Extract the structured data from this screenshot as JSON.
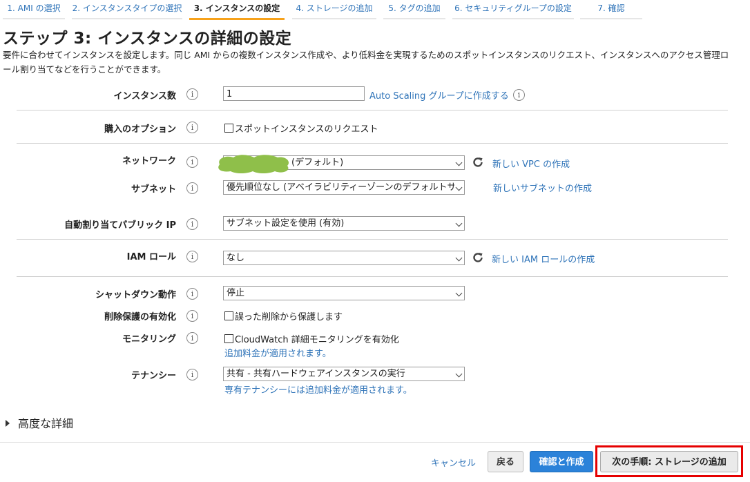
{
  "tabs": [
    {
      "label": "1. AMI の選択"
    },
    {
      "label": "2. インスタンスタイプの選択"
    },
    {
      "label": "3. インスタンスの設定"
    },
    {
      "label": "4. ストレージの追加"
    },
    {
      "label": "5. タグの追加"
    },
    {
      "label": "6. セキュリティグループの設定"
    },
    {
      "label": "7. 確認"
    }
  ],
  "page_title": "ステップ 3: インスタンスの詳細の設定",
  "description": "要件に合わせてインスタンスを設定します。同じ AMI からの複数インスタンス作成や、より低料金を実現するためのスポットインスタンスのリクエスト、インスタンスへのアクセス管理ロール割り当てなどを行うことができます。",
  "info_glyph": "i",
  "form": {
    "instance_count": {
      "label": "インスタンス数",
      "value": "1",
      "link": "Auto Scaling グループに作成する"
    },
    "purchase_option": {
      "label": "購入のオプション",
      "checkbox": "スポットインスタンスのリクエスト"
    },
    "network": {
      "label": "ネットワーク",
      "value": "(デフォルト)",
      "link": "新しい VPC の作成"
    },
    "subnet": {
      "label": "サブネット",
      "value": "優先順位なし (アベイラビリティーゾーンのデフォルトサブ",
      "link": "新しいサブネットの作成"
    },
    "public_ip": {
      "label": "自動割り当てパブリック IP",
      "value": "サブネット設定を使用 (有効)"
    },
    "iam_role": {
      "label": "IAM ロール",
      "value": "なし",
      "link": "新しい IAM ロールの作成"
    },
    "shutdown": {
      "label": "シャットダウン動作",
      "value": "停止"
    },
    "termination": {
      "label": "削除保護の有効化",
      "checkbox": "誤った削除から保護します"
    },
    "monitoring": {
      "label": "モニタリング",
      "checkbox": "CloudWatch 詳細モニタリングを有効化",
      "note": "追加料金が適用されます。"
    },
    "tenancy": {
      "label": "テナンシー",
      "value": "共有 - 共有ハードウェアインスタンスの実行",
      "note": "専有テナンシーには追加料金が適用されます。"
    }
  },
  "advanced": {
    "label": "高度な詳細"
  },
  "footer": {
    "cancel": "キャンセル",
    "back": "戻る",
    "review": "確認と作成",
    "next": "次の手順: ストレージの追加"
  },
  "colors": {
    "accent": "#f7a21b",
    "link": "#2e73b8",
    "primary_button": "#2b82d9",
    "highlight": "#e60000",
    "redaction": "#8fbf4a"
  }
}
